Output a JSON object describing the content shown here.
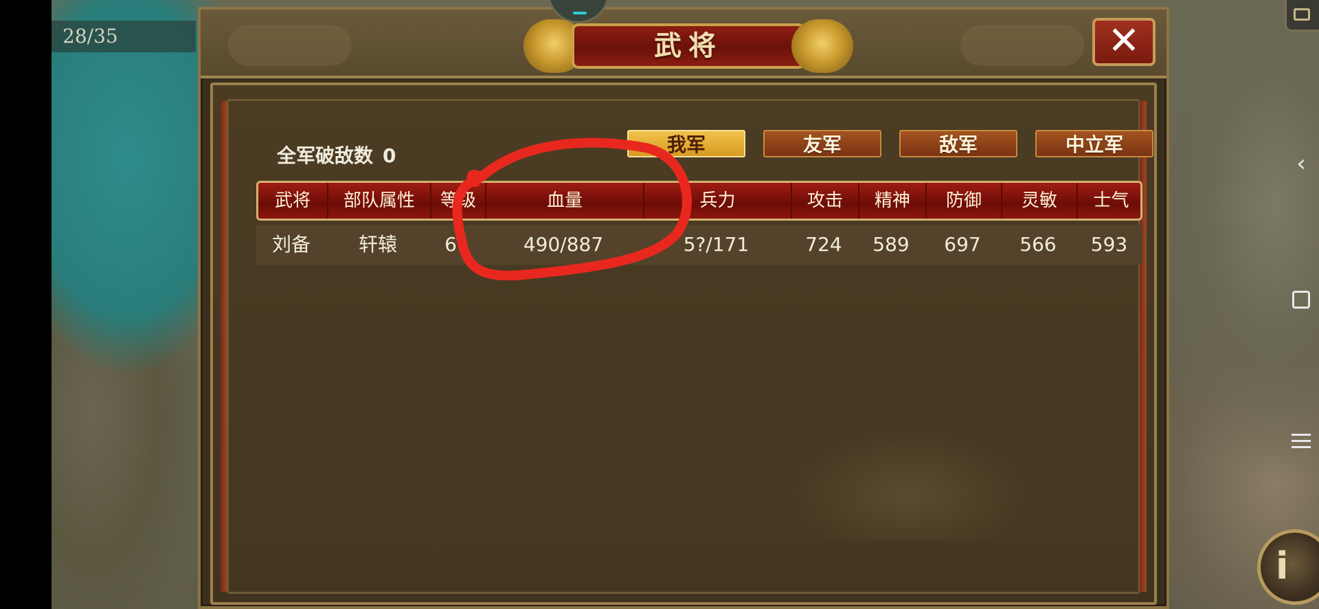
{
  "hud": {
    "counter": "28/35"
  },
  "dialog": {
    "title": "武将",
    "close_icon": "close-icon",
    "summary": {
      "label": "全军破敌数",
      "value": "0"
    },
    "tabs": [
      {
        "label": "我军",
        "active": true
      },
      {
        "label": "友军",
        "active": false
      },
      {
        "label": "敌军",
        "active": false
      },
      {
        "label": "中立军",
        "active": false
      }
    ],
    "table": {
      "headers": [
        "武将",
        "部队属性",
        "等级",
        "血量",
        "兵力",
        "攻击",
        "精神",
        "防御",
        "灵敏",
        "士气"
      ],
      "rows": [
        [
          "刘备",
          "轩辕",
          "61",
          "490/887",
          "5?/171",
          "724",
          "589",
          "697",
          "566",
          "593"
        ]
      ]
    }
  },
  "system_nav": {
    "back_icon": "back-icon",
    "home_icon": "home-icon",
    "menu_icon": "menu-icon"
  },
  "colors": {
    "annotation": "#e8281e",
    "title_red": "#8b1d12",
    "tab_active": "#e0a82c"
  }
}
